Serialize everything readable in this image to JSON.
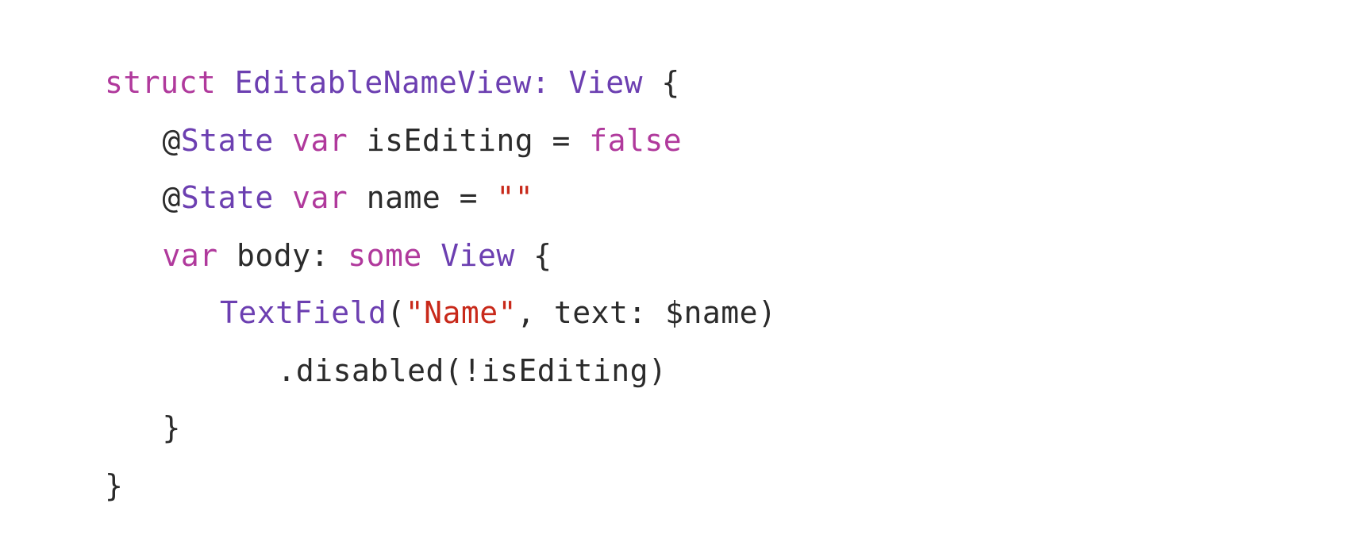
{
  "colors": {
    "plain": "#2b2b2b",
    "keyword": "#b0399c",
    "type": "#6c3fb1",
    "string": "#c8291a",
    "background": "#ffffff"
  },
  "code": {
    "language": "swift",
    "lines": [
      {
        "indent": 0,
        "tokens": [
          {
            "text": "struct",
            "kind": "keyword"
          },
          {
            "text": " ",
            "kind": "plain"
          },
          {
            "text": "EditableNameView",
            "kind": "type"
          },
          {
            "text": ": ",
            "kind": "type"
          },
          {
            "text": "View",
            "kind": "type"
          },
          {
            "text": " {",
            "kind": "plain"
          }
        ]
      },
      {
        "indent": 1,
        "tokens": [
          {
            "text": "@",
            "kind": "plain"
          },
          {
            "text": "State",
            "kind": "type"
          },
          {
            "text": " ",
            "kind": "plain"
          },
          {
            "text": "var",
            "kind": "keyword"
          },
          {
            "text": " isEditing = ",
            "kind": "plain"
          },
          {
            "text": "false",
            "kind": "keyword"
          }
        ]
      },
      {
        "indent": 1,
        "tokens": [
          {
            "text": "@",
            "kind": "plain"
          },
          {
            "text": "State",
            "kind": "type"
          },
          {
            "text": " ",
            "kind": "plain"
          },
          {
            "text": "var",
            "kind": "keyword"
          },
          {
            "text": " name = ",
            "kind": "plain"
          },
          {
            "text": "\"\"",
            "kind": "string"
          }
        ]
      },
      {
        "indent": 1,
        "tokens": [
          {
            "text": "var",
            "kind": "keyword"
          },
          {
            "text": " body: ",
            "kind": "plain"
          },
          {
            "text": "some",
            "kind": "keyword"
          },
          {
            "text": " ",
            "kind": "plain"
          },
          {
            "text": "View",
            "kind": "type"
          },
          {
            "text": " {",
            "kind": "plain"
          }
        ]
      },
      {
        "indent": 2,
        "tokens": [
          {
            "text": "TextField",
            "kind": "type"
          },
          {
            "text": "(",
            "kind": "plain"
          },
          {
            "text": "\"Name\"",
            "kind": "string"
          },
          {
            "text": ", text: $name)",
            "kind": "plain"
          }
        ]
      },
      {
        "indent": 3,
        "tokens": [
          {
            "text": ".disabled(!isEditing)",
            "kind": "plain"
          }
        ]
      },
      {
        "indent": 1,
        "tokens": [
          {
            "text": "}",
            "kind": "plain"
          }
        ]
      },
      {
        "indent": 0,
        "tokens": [
          {
            "text": "}",
            "kind": "plain"
          }
        ]
      }
    ]
  }
}
